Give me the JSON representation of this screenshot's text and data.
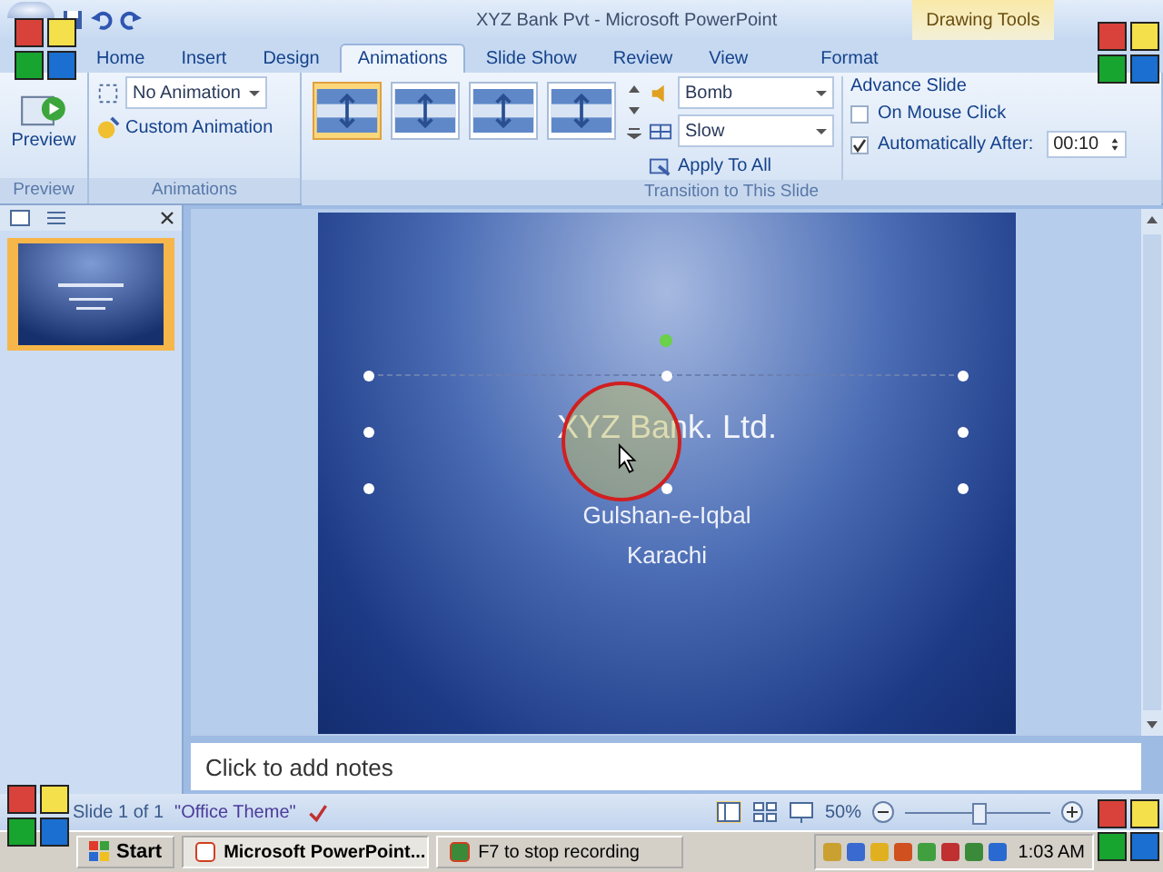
{
  "window": {
    "title": "XYZ Bank Pvt - Microsoft PowerPoint",
    "contextual_tab": "Drawing Tools"
  },
  "tabs": [
    {
      "label": "Home",
      "selected": false
    },
    {
      "label": "Insert",
      "selected": false
    },
    {
      "label": "Design",
      "selected": false
    },
    {
      "label": "Animations",
      "selected": true
    },
    {
      "label": "Slide Show",
      "selected": false
    },
    {
      "label": "Review",
      "selected": false
    },
    {
      "label": "View",
      "selected": false
    },
    {
      "label": "Format",
      "selected": false
    }
  ],
  "preview_group": {
    "button": "Preview",
    "label": "Preview"
  },
  "animations_group": {
    "dropdown": "No Animation",
    "custom": "Custom Animation",
    "label": "Animations"
  },
  "transition_group": {
    "transitions": [
      {
        "selected": true
      },
      {
        "selected": false
      },
      {
        "selected": false
      },
      {
        "selected": false
      }
    ],
    "sound": "Bomb",
    "speed": "Slow",
    "apply_all": "Apply To All",
    "label": "Transition to This Slide"
  },
  "advance": {
    "title": "Advance Slide",
    "on_click": {
      "label": "On Mouse Click",
      "checked": false
    },
    "auto": {
      "label": "Automatically After:",
      "checked": true,
      "value": "00:10"
    }
  },
  "slides_pane": {
    "thumbnails": [
      {
        "selected": true
      }
    ]
  },
  "slide": {
    "title": "XYZ Bank. Ltd.",
    "lines": [
      "Gulshan-e-Iqbal",
      "Karachi"
    ]
  },
  "notes": {
    "placeholder": "Click to add notes"
  },
  "status_bar": {
    "slide": "Slide 1 of 1",
    "theme": "\"Office Theme\"",
    "zoom": "50%",
    "zoom_slider": {
      "level": 0.5
    }
  },
  "taskbar": {
    "start": "Start",
    "tasks": [
      {
        "label": "Microsoft PowerPoint...",
        "selected": true
      },
      {
        "label": "F7 to stop recording",
        "selected": false
      }
    ],
    "clock": "1:03 AM"
  }
}
